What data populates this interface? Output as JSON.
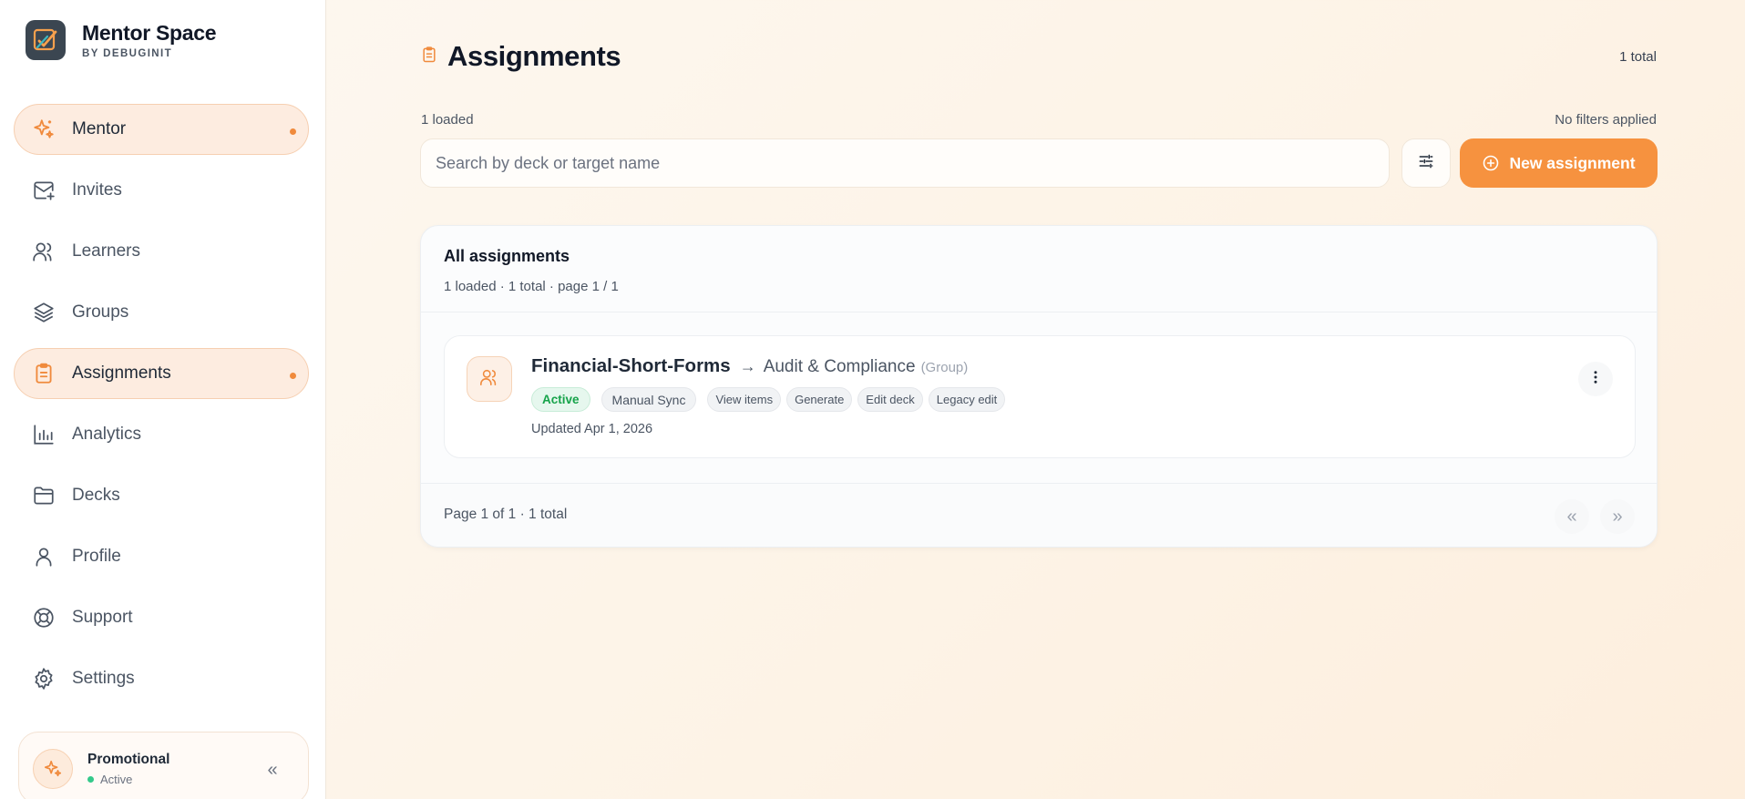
{
  "brand": {
    "title": "Mentor Space",
    "subtitle": "BY DEBUGINIT"
  },
  "sidebar": {
    "items": [
      {
        "label": "Mentor",
        "icon": "sparkles-icon",
        "active": true
      },
      {
        "label": "Invites",
        "icon": "mail-plus-icon",
        "active": false
      },
      {
        "label": "Learners",
        "icon": "users-icon",
        "active": false
      },
      {
        "label": "Groups",
        "icon": "layers-icon",
        "active": false
      },
      {
        "label": "Assignments",
        "icon": "clipboard-icon",
        "active": true
      },
      {
        "label": "Analytics",
        "icon": "bar-chart-icon",
        "active": false
      },
      {
        "label": "Decks",
        "icon": "folder-icon",
        "active": false
      },
      {
        "label": "Profile",
        "icon": "user-icon",
        "active": false
      },
      {
        "label": "Support",
        "icon": "life-buoy-icon",
        "active": false
      },
      {
        "label": "Settings",
        "icon": "gear-icon",
        "active": false
      }
    ],
    "plan": {
      "name": "Promotional",
      "status": "Active"
    }
  },
  "main": {
    "title": "Assignments",
    "total_top": "1 total",
    "loaded_label": "1 loaded",
    "filters_label": "No filters applied",
    "search": {
      "placeholder": "Search by deck or target name",
      "value": ""
    },
    "new_button_label": "New assignment",
    "panel": {
      "title": "All assignments",
      "subtitle": "1 loaded · 1 total · page 1 / 1",
      "rows": [
        {
          "deck": "Financial-Short-Forms",
          "arrow": "→",
          "target": "Audit & Compliance",
          "target_type": "(Group)",
          "status": "Active",
          "sync": "Manual Sync",
          "actions": [
            "View items",
            "Generate",
            "Edit deck",
            "Legacy edit"
          ],
          "updated": "Updated Apr 1, 2026"
        }
      ],
      "footer": {
        "page_info": "Page 1 of 1 · 1 total",
        "prev": "«",
        "next": "»"
      }
    }
  },
  "colors": {
    "accent": "#f6923f",
    "active_bg": "#fdece0",
    "status_green": "#16a34a"
  }
}
